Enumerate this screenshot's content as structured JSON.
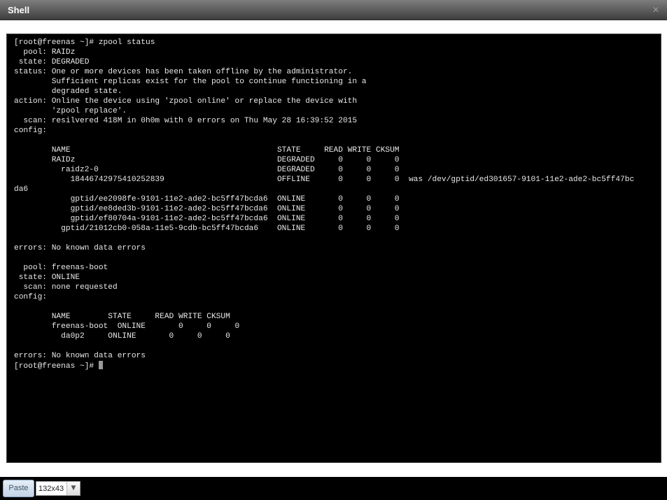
{
  "window": {
    "title": "Shell",
    "close_glyph": "✕"
  },
  "terminal": {
    "text": "[root@freenas ~]# zpool status\n  pool: RAIDz\n state: DEGRADED\nstatus: One or more devices has been taken offline by the administrator.\n        Sufficient replicas exist for the pool to continue functioning in a\n        degraded state.\naction: Online the device using 'zpool online' or replace the device with\n        'zpool replace'.\n  scan: resilvered 418M in 0h0m with 0 errors on Thu May 28 16:39:52 2015\nconfig:\n\n        NAME                                            STATE     READ WRITE CKSUM\n        RAIDz                                           DEGRADED     0     0     0\n          raidz2-0                                      DEGRADED     0     0     0\n            18446742975410252839                        OFFLINE      0     0     0  was /dev/gptid/ed301657-9101-11e2-ade2-bc5ff47bc\nda6\n            gptid/ee2098fe-9101-11e2-ade2-bc5ff47bcda6  ONLINE       0     0     0\n            gptid/ee8ded3b-9101-11e2-ade2-bc5ff47bcda6  ONLINE       0     0     0\n            gptid/ef80704a-9101-11e2-ade2-bc5ff47bcda6  ONLINE       0     0     0\n          gptid/21012cb0-058a-11e5-9cdb-bc5ff47bcda6    ONLINE       0     0     0\n\nerrors: No known data errors\n\n  pool: freenas-boot\n state: ONLINE\n  scan: none requested\nconfig:\n\n        NAME        STATE     READ WRITE CKSUM\n        freenas-boot  ONLINE       0     0     0\n          da0p2     ONLINE       0     0     0\n\nerrors: No known data errors\n",
    "prompt": "[root@freenas ~]# "
  },
  "bottom_bar": {
    "paste_label": "Paste",
    "size_value": "132x43",
    "size_arrow_glyph": "▼"
  }
}
